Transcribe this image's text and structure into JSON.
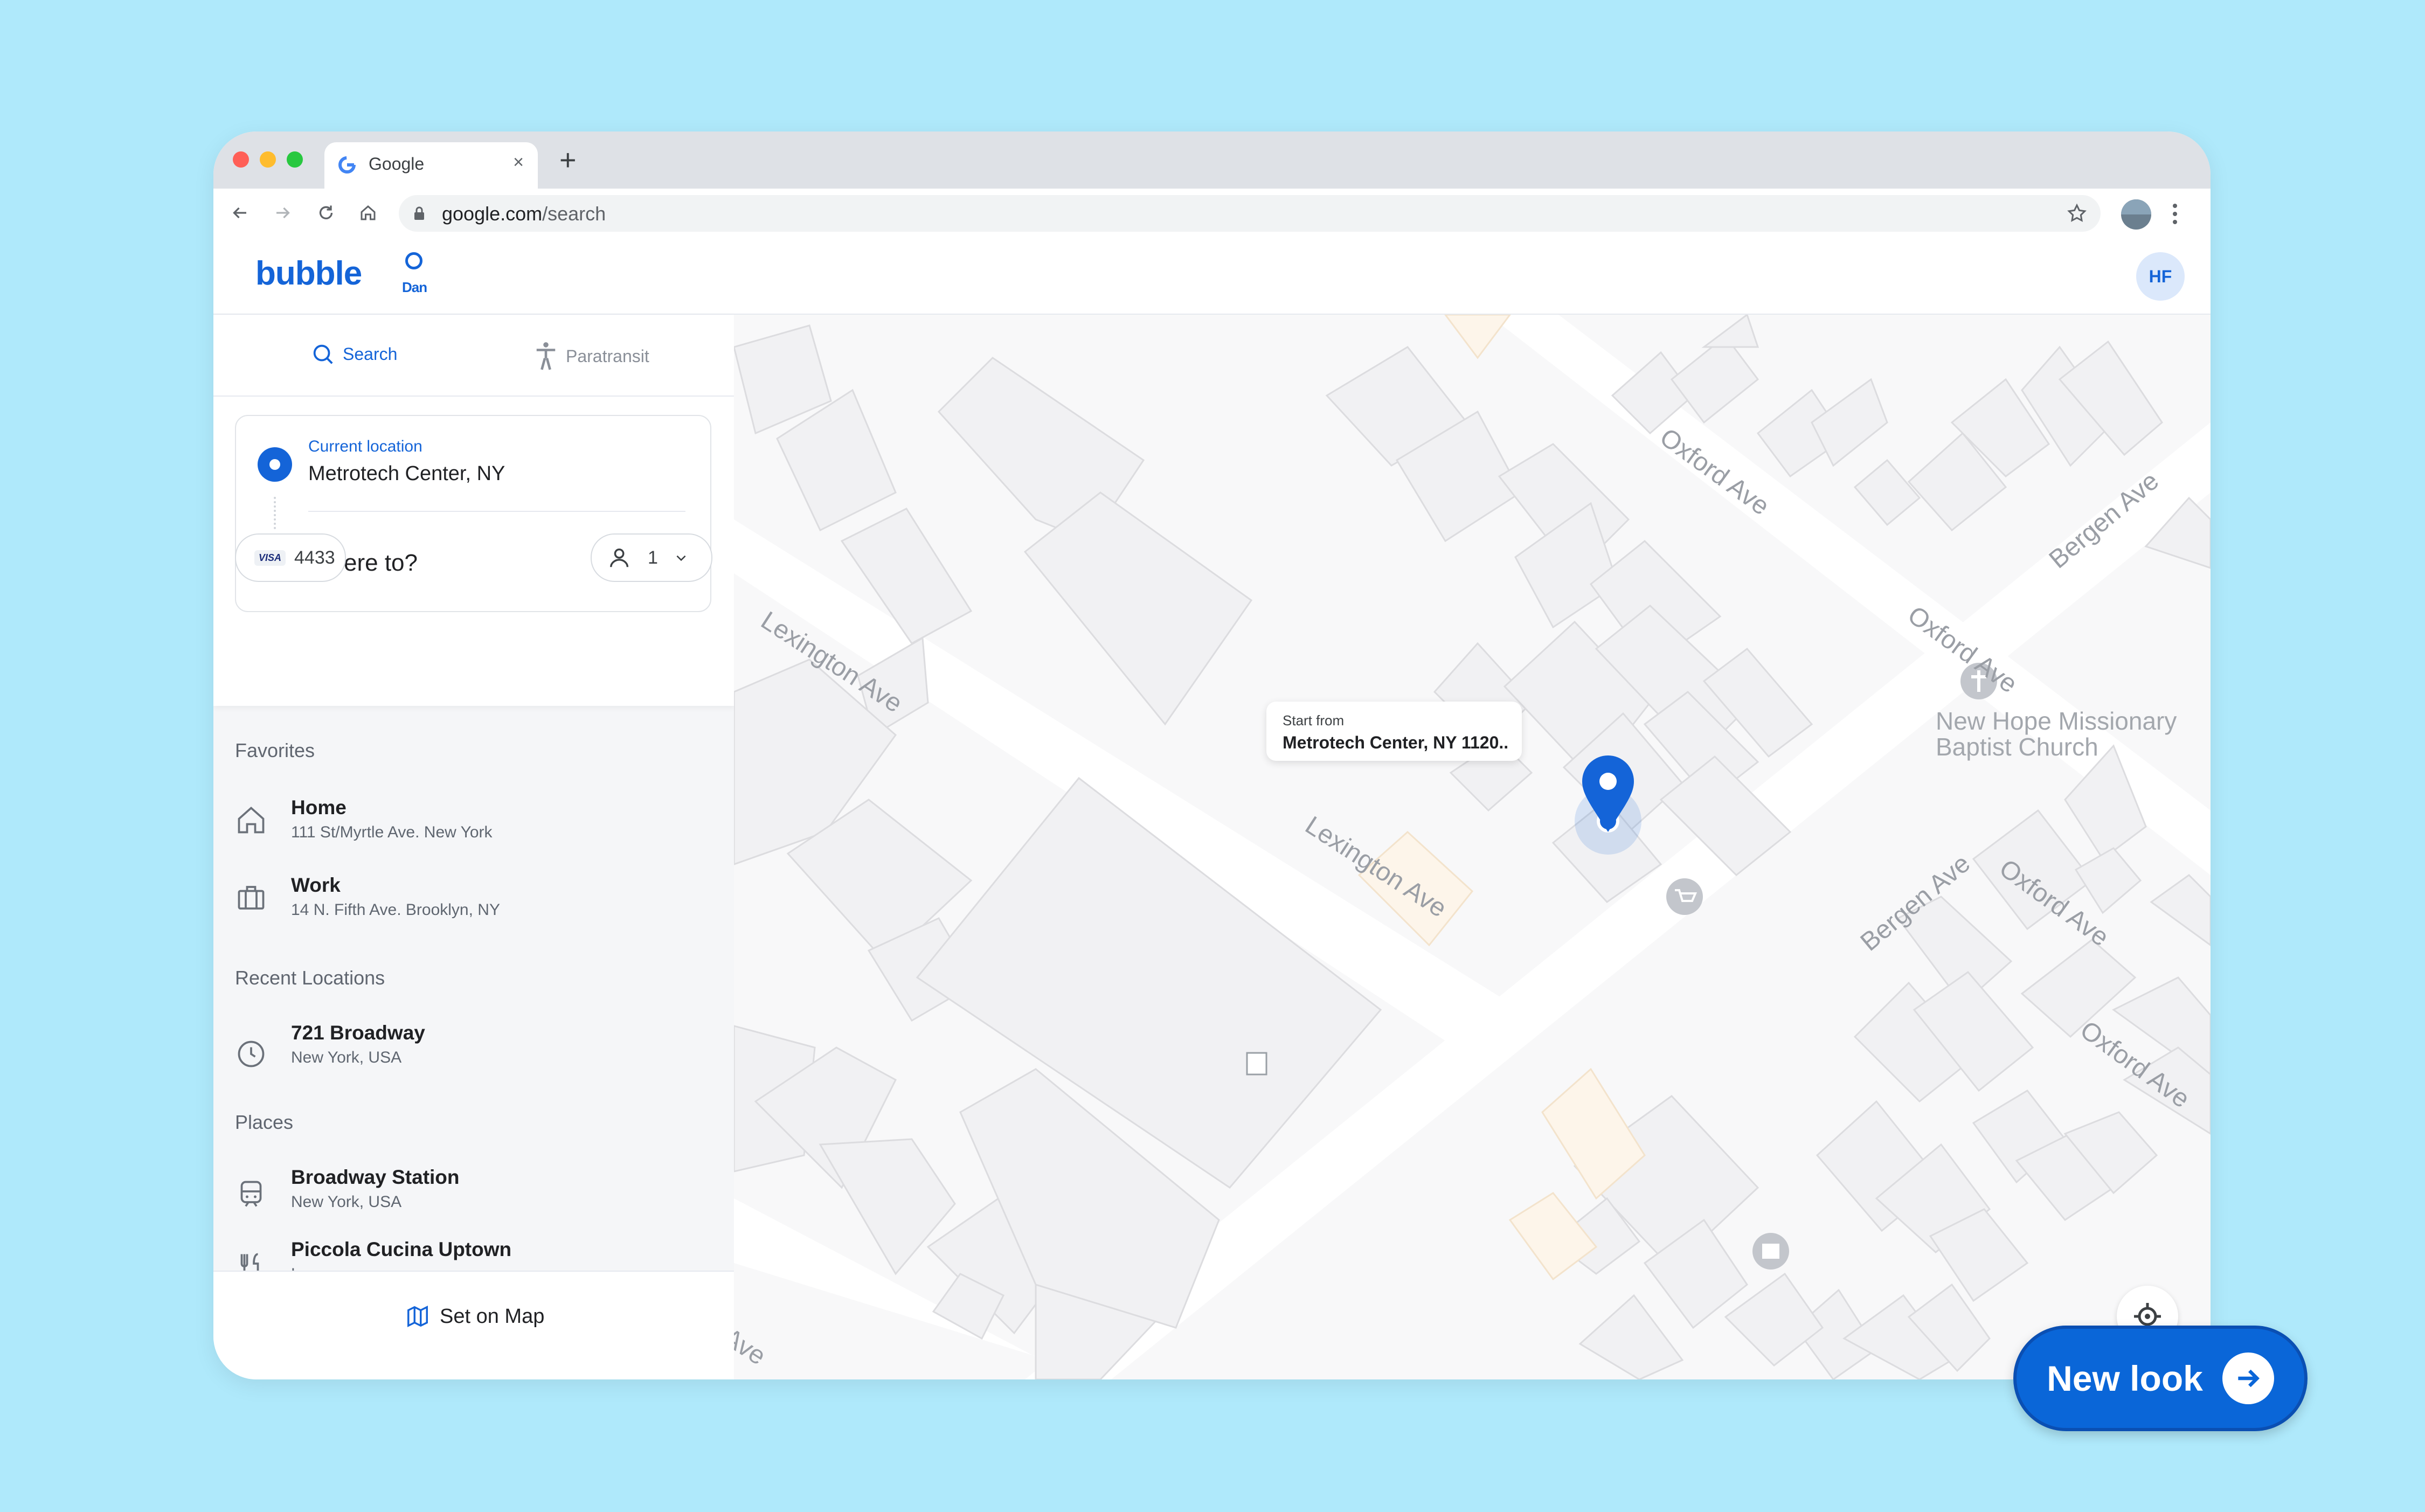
{
  "browser": {
    "tab_title": "Google",
    "new_tab": "+",
    "tab_close": "×",
    "url_domain": "google.com",
    "url_path": "/search"
  },
  "app": {
    "logo_text": "bubble",
    "logo_sub": "Dan",
    "avatar_initials": "HF"
  },
  "sidebar": {
    "tabs": [
      {
        "label": "Search",
        "icon": "search-icon",
        "active": true
      },
      {
        "label": "Paratransit",
        "icon": "accessibility-icon",
        "active": false
      }
    ],
    "origin": {
      "label": "Current location",
      "value": "Metrotech Center, NY"
    },
    "destination": {
      "placeholder": "Where to?"
    },
    "payment": {
      "brand": "VISA",
      "last4": "4433"
    },
    "passengers": {
      "count": "1"
    },
    "favorites_title": "Favorites",
    "favorites": [
      {
        "name": "Home",
        "address": "111 St/Myrtle Ave. New York",
        "icon": "home-icon"
      },
      {
        "name": "Work",
        "address": "14 N. Fifth Ave. Brooklyn, NY",
        "icon": "briefcase-icon"
      }
    ],
    "recent_title": "Recent Locations",
    "recent": [
      {
        "name": "721 Broadway",
        "address": "New York, USA",
        "icon": "clock-icon"
      }
    ],
    "places_title": "Places",
    "places": [
      {
        "name": "Broadway Station",
        "address": "New York, USA",
        "icon": "train-icon"
      },
      {
        "name": "Piccola Cucina Uptown",
        "address": "Leuven",
        "icon": "fork-knife-icon"
      }
    ],
    "set_on_map": "Set on Map"
  },
  "map": {
    "tooltip": {
      "label": "Start from",
      "value": "Metrotech Center, NY 1120.."
    },
    "streets": [
      "Lexington Ave",
      "Lexington Ave",
      "Ave",
      "Oxford Ave",
      "Oxford Ave",
      "Oxford Ave",
      "Oxford Ave",
      "Bergen Ave",
      "Bergen Ave"
    ],
    "poi": {
      "line1": "New Hope Missionary",
      "line2": "Baptist Church"
    }
  },
  "cta": {
    "label": "New look"
  },
  "colors": {
    "brand": "#1464d8",
    "background": "#afe9fb",
    "cta": "#0a66d8"
  }
}
